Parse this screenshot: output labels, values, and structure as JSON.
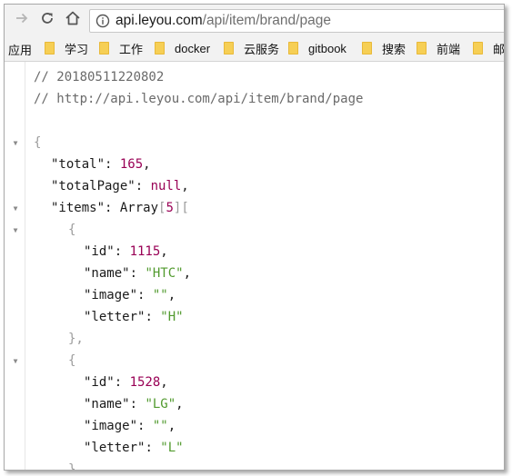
{
  "browser": {
    "url_domain": "api.leyou.com",
    "url_path": "/api/item/brand/page"
  },
  "bookmarks": {
    "apps_label": "应用",
    "items": [
      "学习",
      "工作",
      "docker",
      "云服务",
      "gitbook",
      "搜索",
      "前端",
      "邮"
    ]
  },
  "json_view": {
    "comment_timestamp": "// 20180511220802",
    "comment_url": "// http://api.leyou.com/api/item/brand/page",
    "open_brace": "{",
    "total_key": "\"total\"",
    "total_value": "165",
    "totalPage_key": "\"totalPage\"",
    "totalPage_value": "null",
    "items_key": "\"items\"",
    "items_type": "Array",
    "items_length": "5",
    "item_open": "{",
    "item_close": "},",
    "items": [
      {
        "id_key": "\"id\"",
        "id": "1115",
        "name_key": "\"name\"",
        "name": "\"HTC\"",
        "image_key": "\"image\"",
        "image": "\"\"",
        "letter_key": "\"letter\"",
        "letter": "\"H\""
      },
      {
        "id_key": "\"id\"",
        "id": "1528",
        "name_key": "\"name\"",
        "name": "\"LG\"",
        "image_key": "\"image\"",
        "image": "\"\"",
        "letter_key": "\"letter\"",
        "letter": "\"L\""
      }
    ]
  }
}
